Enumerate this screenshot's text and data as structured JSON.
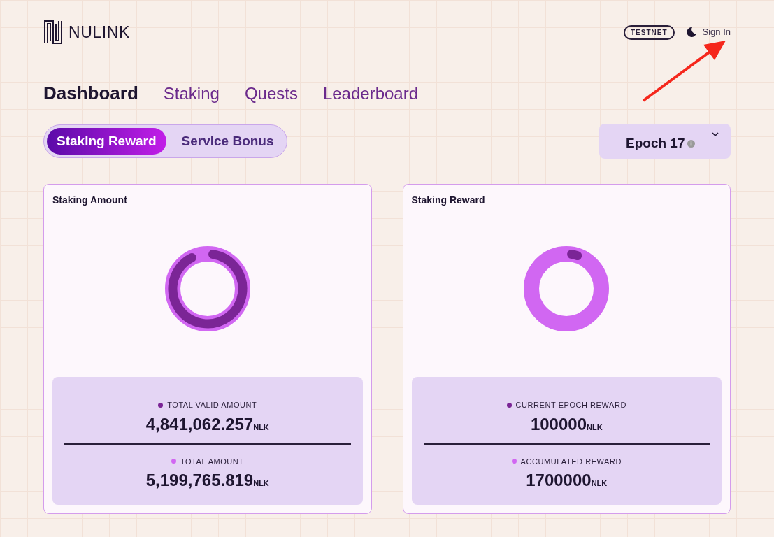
{
  "header": {
    "logo_text": "NULINK",
    "network_badge": "TESTNET",
    "sign_in": "Sign In"
  },
  "nav": [
    {
      "label": "Dashboard",
      "selected": true
    },
    {
      "label": "Staking",
      "selected": false
    },
    {
      "label": "Quests",
      "selected": false
    },
    {
      "label": "Leaderboard",
      "selected": false
    }
  ],
  "segments": [
    {
      "label": "Staking Reward",
      "selected": true
    },
    {
      "label": "Service Bonus",
      "selected": false
    }
  ],
  "epoch_select": {
    "value": "Epoch 17"
  },
  "cards": [
    {
      "title": "Staking Amount",
      "stats": [
        {
          "label": "TOTAL VALID AMOUNT",
          "value": "4,841,062.257",
          "unit": "NLK",
          "color": "#7b2596"
        },
        {
          "label": "TOTAL AMOUNT",
          "value": "5,199,765.819",
          "unit": "NLK",
          "color": "#d167f2"
        }
      ]
    },
    {
      "title": "Staking Reward",
      "stats": [
        {
          "label": "CURRENT EPOCH REWARD",
          "value": "100000",
          "unit": "NLK",
          "color": "#7b2596"
        },
        {
          "label": "ACCUMULATED REWARD",
          "value": "1700000",
          "unit": "NLK",
          "color": "#d167f2"
        }
      ]
    }
  ]
}
